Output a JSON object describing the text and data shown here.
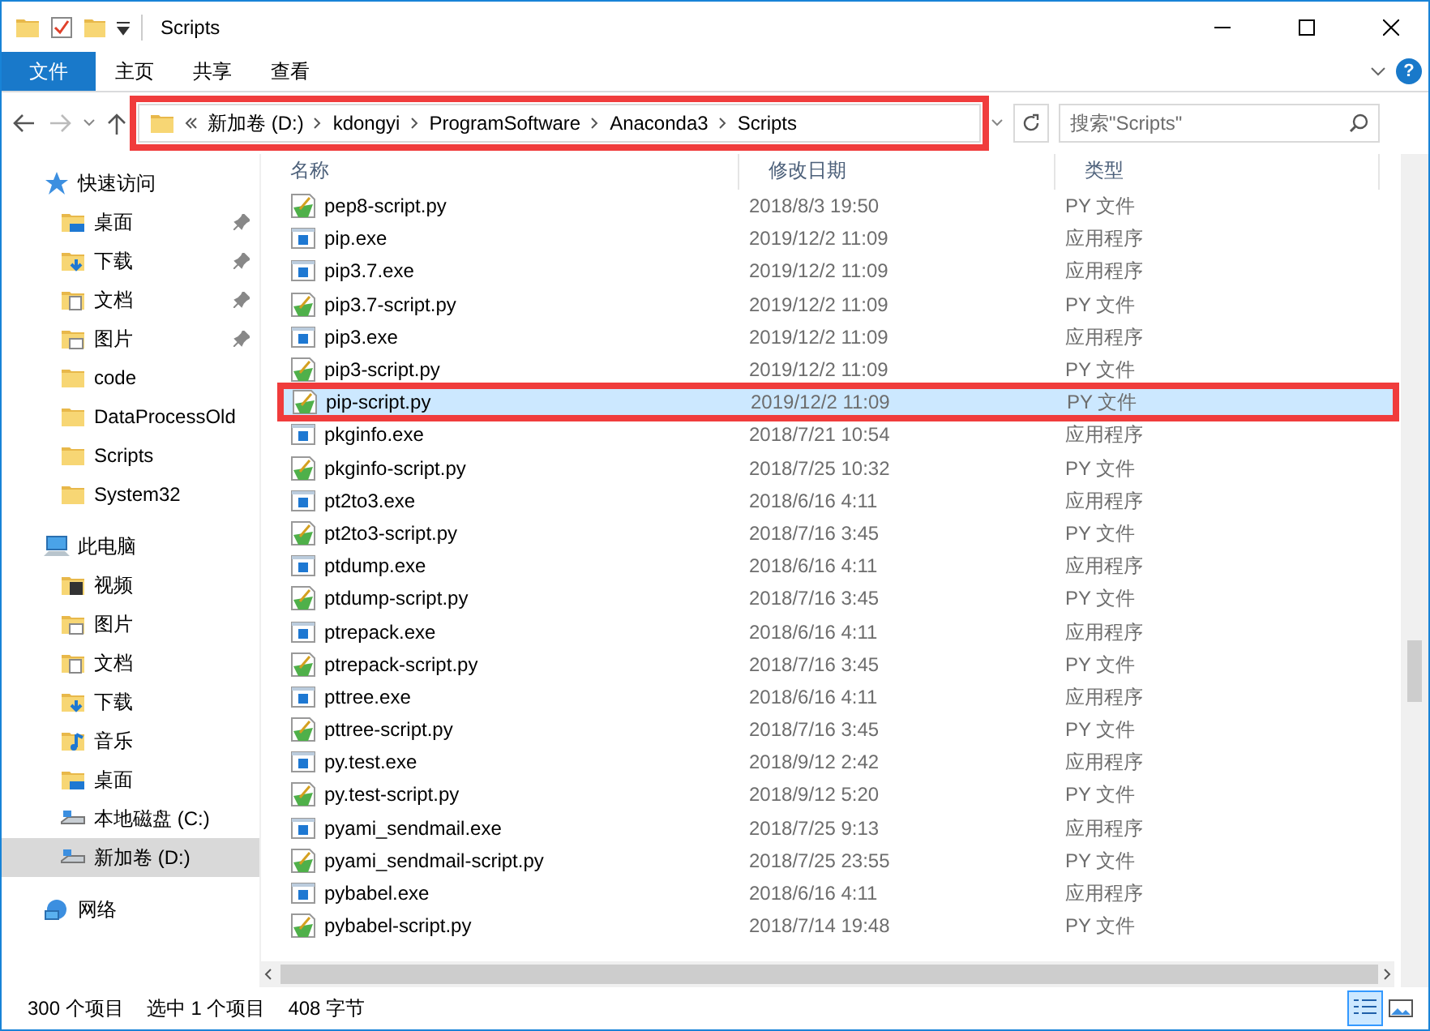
{
  "window": {
    "title": "Scripts"
  },
  "ribbon_tabs": [
    {
      "label": "文件",
      "selected": true
    },
    {
      "label": "主页",
      "selected": false
    },
    {
      "label": "共享",
      "selected": false
    },
    {
      "label": "查看",
      "selected": false
    }
  ],
  "help": "?",
  "address_bar": {
    "highlighted": true,
    "segments": [
      "新加卷 (D:)",
      "kdongyi",
      "ProgramSoftware",
      "Anaconda3",
      "Scripts"
    ]
  },
  "search": {
    "placeholder": "搜索\"Scripts\""
  },
  "sidebar": {
    "items": [
      {
        "label": "快速访问",
        "kind": "star",
        "selected": false,
        "children": [
          {
            "label": "桌面",
            "kind": "desktop",
            "pinned": true,
            "selected": false
          },
          {
            "label": "下载",
            "kind": "download",
            "pinned": true,
            "selected": false
          },
          {
            "label": "文档",
            "kind": "document",
            "pinned": true,
            "selected": false
          },
          {
            "label": "图片",
            "kind": "picture",
            "pinned": true,
            "selected": false
          },
          {
            "label": "code",
            "kind": "folder",
            "pinned": false,
            "selected": false
          },
          {
            "label": "DataProcessOld",
            "kind": "folder",
            "pinned": false,
            "selected": false
          },
          {
            "label": "Scripts",
            "kind": "folder",
            "pinned": false,
            "selected": false
          },
          {
            "label": "System32",
            "kind": "folder",
            "pinned": false,
            "selected": false
          }
        ]
      },
      {
        "label": "此电脑",
        "kind": "computer",
        "selected": false,
        "children": [
          {
            "label": "视频",
            "kind": "video",
            "pinned": false,
            "selected": false
          },
          {
            "label": "图片",
            "kind": "picture",
            "pinned": false,
            "selected": false
          },
          {
            "label": "文档",
            "kind": "document",
            "pinned": false,
            "selected": false
          },
          {
            "label": "下载",
            "kind": "download",
            "pinned": false,
            "selected": false
          },
          {
            "label": "音乐",
            "kind": "music",
            "pinned": false,
            "selected": false
          },
          {
            "label": "桌面",
            "kind": "desktop",
            "pinned": false,
            "selected": false
          },
          {
            "label": "本地磁盘 (C:)",
            "kind": "drive",
            "pinned": false,
            "selected": false
          },
          {
            "label": "新加卷 (D:)",
            "kind": "drive",
            "pinned": false,
            "selected": true
          }
        ]
      },
      {
        "label": "网络",
        "kind": "network",
        "selected": false
      }
    ]
  },
  "table": {
    "columns": [
      "名称",
      "修改日期",
      "类型"
    ],
    "rows": [
      {
        "name": "pep8-script.py",
        "date": "2018/8/3 19:50",
        "type": "PY 文件",
        "kind": "py",
        "selected": false,
        "highlighted": false
      },
      {
        "name": "pip.exe",
        "date": "2019/12/2 11:09",
        "type": "应用程序",
        "kind": "exe",
        "selected": false,
        "highlighted": false
      },
      {
        "name": "pip3.7.exe",
        "date": "2019/12/2 11:09",
        "type": "应用程序",
        "kind": "exe",
        "selected": false,
        "highlighted": false
      },
      {
        "name": "pip3.7-script.py",
        "date": "2019/12/2 11:09",
        "type": "PY 文件",
        "kind": "py",
        "selected": false,
        "highlighted": false
      },
      {
        "name": "pip3.exe",
        "date": "2019/12/2 11:09",
        "type": "应用程序",
        "kind": "exe",
        "selected": false,
        "highlighted": false
      },
      {
        "name": "pip3-script.py",
        "date": "2019/12/2 11:09",
        "type": "PY 文件",
        "kind": "py",
        "selected": false,
        "highlighted": false
      },
      {
        "name": "pip-script.py",
        "date": "2019/12/2 11:09",
        "type": "PY 文件",
        "kind": "py",
        "selected": true,
        "highlighted": true
      },
      {
        "name": "pkginfo.exe",
        "date": "2018/7/21 10:54",
        "type": "应用程序",
        "kind": "exe",
        "selected": false,
        "highlighted": false
      },
      {
        "name": "pkginfo-script.py",
        "date": "2018/7/25 10:32",
        "type": "PY 文件",
        "kind": "py",
        "selected": false,
        "highlighted": false
      },
      {
        "name": "pt2to3.exe",
        "date": "2018/6/16 4:11",
        "type": "应用程序",
        "kind": "exe",
        "selected": false,
        "highlighted": false
      },
      {
        "name": "pt2to3-script.py",
        "date": "2018/7/16 3:45",
        "type": "PY 文件",
        "kind": "py",
        "selected": false,
        "highlighted": false
      },
      {
        "name": "ptdump.exe",
        "date": "2018/6/16 4:11",
        "type": "应用程序",
        "kind": "exe",
        "selected": false,
        "highlighted": false
      },
      {
        "name": "ptdump-script.py",
        "date": "2018/7/16 3:45",
        "type": "PY 文件",
        "kind": "py",
        "selected": false,
        "highlighted": false
      },
      {
        "name": "ptrepack.exe",
        "date": "2018/6/16 4:11",
        "type": "应用程序",
        "kind": "exe",
        "selected": false,
        "highlighted": false
      },
      {
        "name": "ptrepack-script.py",
        "date": "2018/7/16 3:45",
        "type": "PY 文件",
        "kind": "py",
        "selected": false,
        "highlighted": false
      },
      {
        "name": "pttree.exe",
        "date": "2018/6/16 4:11",
        "type": "应用程序",
        "kind": "exe",
        "selected": false,
        "highlighted": false
      },
      {
        "name": "pttree-script.py",
        "date": "2018/7/16 3:45",
        "type": "PY 文件",
        "kind": "py",
        "selected": false,
        "highlighted": false
      },
      {
        "name": "py.test.exe",
        "date": "2018/9/12 2:42",
        "type": "应用程序",
        "kind": "exe",
        "selected": false,
        "highlighted": false
      },
      {
        "name": "py.test-script.py",
        "date": "2018/9/12 5:20",
        "type": "PY 文件",
        "kind": "py",
        "selected": false,
        "highlighted": false
      },
      {
        "name": "pyami_sendmail.exe",
        "date": "2018/7/25 9:13",
        "type": "应用程序",
        "kind": "exe",
        "selected": false,
        "highlighted": false
      },
      {
        "name": "pyami_sendmail-script.py",
        "date": "2018/7/25 23:55",
        "type": "PY 文件",
        "kind": "py",
        "selected": false,
        "highlighted": false
      },
      {
        "name": "pybabel.exe",
        "date": "2018/6/16 4:11",
        "type": "应用程序",
        "kind": "exe",
        "selected": false,
        "highlighted": false
      },
      {
        "name": "pybabel-script.py",
        "date": "2018/7/14 19:48",
        "type": "PY 文件",
        "kind": "py",
        "selected": false,
        "highlighted": false
      }
    ]
  },
  "status_bar": {
    "count": "300 个项目",
    "selection": "选中 1 个项目",
    "size": "408 字节"
  },
  "view_buttons": [
    {
      "kind": "details",
      "selected": true
    },
    {
      "kind": "large-icons",
      "selected": false
    }
  ]
}
